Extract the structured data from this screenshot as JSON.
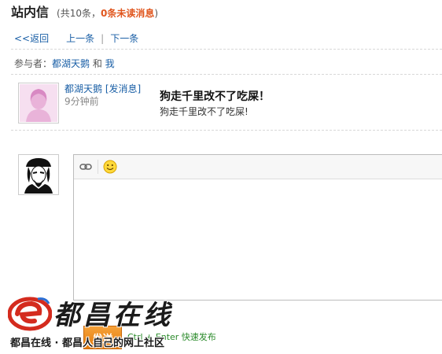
{
  "header": {
    "title": "站内信",
    "count_prefix": "(共10条，",
    "unread": "0条未读消息",
    "count_suffix": ")"
  },
  "nav": {
    "back": "<<返回",
    "prev": "上一条",
    "separator": "|",
    "next": "下一条"
  },
  "participants": {
    "label": "参与者：",
    "user1": "都湖天鹅",
    "conjunction": " 和 ",
    "user2": "我"
  },
  "message": {
    "sender": "都湖天鹅",
    "send_link": "[发消息]",
    "time": "9分钟前",
    "subject": "狗走千里改不了吃屎！",
    "body": "狗走千里改不了吃屎!"
  },
  "editor": {
    "tools": [
      "link-icon",
      "smiley-icon"
    ]
  },
  "actions": {
    "send_label": "发送",
    "hint": "Ctrl + Enter 快速发布"
  },
  "brand": {
    "logo_word": "都昌在线",
    "tagline": "都昌在线 · 都昌人自己的网上社区"
  },
  "colors": {
    "link": "#1a5fa6",
    "unread": "#e0561e",
    "send_button": "#f39a2a",
    "hint": "#2a8a2a"
  }
}
